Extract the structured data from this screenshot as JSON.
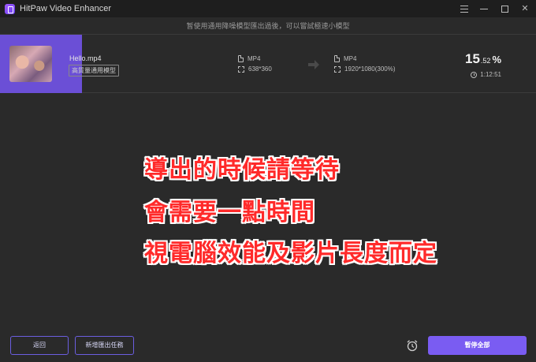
{
  "window": {
    "title": "HitPaw Video Enhancer"
  },
  "notice": {
    "text": "暂使用通用降噪模型匯出過後，可以嘗試極速小模型"
  },
  "task": {
    "file_name": "Hello.mp4",
    "model": "高質量通用模型",
    "source": {
      "format": "MP4",
      "resolution": "638*360"
    },
    "output": {
      "format": "MP4",
      "resolution": "1920*1080(300%)"
    },
    "progress": {
      "main": "15",
      "decimal": ".52",
      "sign": "%"
    },
    "elapsed": "1:12:51"
  },
  "overlay": {
    "line1": "導出的時候請等待",
    "line2": "會需要一點時間",
    "line3": "視電腦效能及影片長度而定"
  },
  "buttons": {
    "back": "返回",
    "add_task": "新增匯出任務",
    "pause_all": "暫停全部"
  },
  "colors": {
    "accent": "#7a5cf2",
    "overlay_text": "#ff2a2a"
  },
  "icons": [
    "app-logo-icon",
    "menu-icon",
    "minimize-icon",
    "maximize-icon",
    "close-icon",
    "file-icon",
    "resolution-icon",
    "arrow-right-icon",
    "clock-icon",
    "alarm-icon"
  ]
}
